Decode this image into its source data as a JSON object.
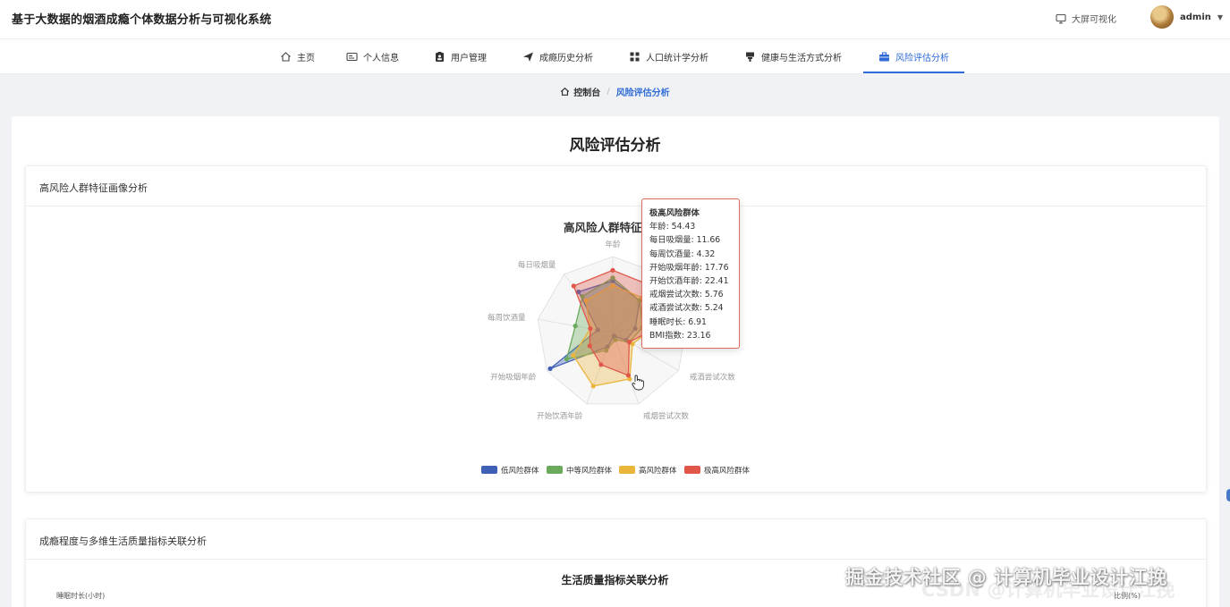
{
  "app": {
    "title": "基于大数据的烟酒成瘾个体数据分析与可视化系统"
  },
  "header": {
    "bigscreen_label": "大屏可视化",
    "username": "admin"
  },
  "nav": {
    "items": [
      {
        "label": "主页",
        "icon": "home-icon"
      },
      {
        "label": "个人信息",
        "icon": "id-card-icon"
      },
      {
        "label": "用户管理",
        "icon": "clipboard-user-icon"
      },
      {
        "label": "成瘾历史分析",
        "icon": "send-icon"
      },
      {
        "label": "人口统计学分析",
        "icon": "grid-icon"
      },
      {
        "label": "健康与生活方式分析",
        "icon": "cup-icon"
      },
      {
        "label": "风险评估分析",
        "icon": "briefcase-icon"
      }
    ],
    "active_index": 6
  },
  "breadcrumb": {
    "home": "控制台",
    "current": "风险评估分析"
  },
  "page": {
    "heading": "风险评估分析"
  },
  "panel1": {
    "title": "高风险人群特征画像分析"
  },
  "panel2": {
    "title": "成瘾程度与多维生活质量指标关联分析",
    "chart_title": "生活质量指标关联分析",
    "y_label_left": "睡眠时长(小时)",
    "y_label_right": "比例(%)"
  },
  "tooltip": {
    "title": "极高风险群体",
    "lines": [
      "年龄: 54.43",
      "每日吸烟量: 11.66",
      "每周饮酒量: 4.32",
      "开始吸烟年龄: 17.76",
      "开始饮酒年龄: 22.41",
      "戒烟尝试次数: 5.76",
      "戒酒尝试次数: 5.24",
      "睡眠时长: 6.91",
      "BMI指数: 23.16"
    ]
  },
  "watermark": {
    "text": "掘金技术社区 @ 计算机毕业设计江挽",
    "shadow_text": "CSDN @计算机毕业设计江挽"
  },
  "colors": {
    "accent": "#2f6bd6",
    "low": "#4060b8",
    "mid": "#6aaa5a",
    "high": "#eab53b",
    "very_high": "#e0574a"
  },
  "chart_data": {
    "type": "radar",
    "title": "高风险人群特征画像",
    "indicators": [
      "年龄",
      "",
      "",
      "戒酒尝试次数",
      "戒烟尝试次数",
      "开始饮酒年龄",
      "开始吸烟年龄",
      "每周饮酒量",
      "每日吸烟量"
    ],
    "visible_indicator_labels": [
      "年龄",
      "戒酒尝试次数",
      "戒烟尝试次数",
      "开始饮酒年龄",
      "开始吸烟年龄",
      "每周饮酒量",
      "每日吸烟量"
    ],
    "series": [
      {
        "name": "低风险群体",
        "values_relative": [
          0.68,
          0.55,
          0.3,
          0.2,
          0.05,
          0.2,
          0.95,
          0.2,
          0.7
        ]
      },
      {
        "name": "中等风险群体",
        "values_relative": [
          0.72,
          0.55,
          0.4,
          0.25,
          0.1,
          0.25,
          0.7,
          0.5,
          0.62
        ]
      },
      {
        "name": "高风险群体",
        "values_relative": [
          0.62,
          0.6,
          0.6,
          0.3,
          0.65,
          0.75,
          0.6,
          0.3,
          0.55
        ]
      },
      {
        "name": "极高风险群体",
        "values_relative": [
          0.82,
          0.8,
          0.7,
          0.25,
          0.6,
          0.45,
          0.35,
          0.3,
          0.8
        ]
      }
    ],
    "legend_position": "bottom-center"
  }
}
